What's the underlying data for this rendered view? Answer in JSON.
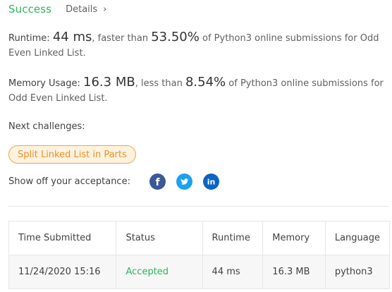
{
  "header": {
    "status": "Success",
    "details_label": "Details",
    "details_chevron": "›"
  },
  "runtime": {
    "label": "Runtime:",
    "value": "44 ms",
    "comparison_text": ", faster than",
    "percent": "53.50%",
    "suffix": "of Python3 online submissions for Odd Even Linked List."
  },
  "memory": {
    "label": "Memory Usage:",
    "value": "16.3 MB",
    "comparison_text": ", less than",
    "percent": "8.54%",
    "suffix": "of Python3 online submissions for Odd Even Linked List."
  },
  "next": {
    "label": "Next challenges:",
    "challenge": "Split Linked List in Parts"
  },
  "share": {
    "label": "Show off your acceptance:",
    "icons": [
      "facebook-icon",
      "twitter-icon",
      "linkedin-icon"
    ]
  },
  "table": {
    "headers": [
      "Time Submitted",
      "Status",
      "Runtime",
      "Memory",
      "Language"
    ],
    "rows": [
      [
        "11/24/2020 15:16",
        "Accepted",
        "44 ms",
        "16.3 MB",
        "python3"
      ]
    ]
  },
  "colors": {
    "success": "#2db55d",
    "challenge_border": "#f0a44a",
    "challenge_bg": "#fff2df",
    "facebook": "#3b5998",
    "twitter": "#1da1f2",
    "linkedin": "#0b66c2"
  }
}
